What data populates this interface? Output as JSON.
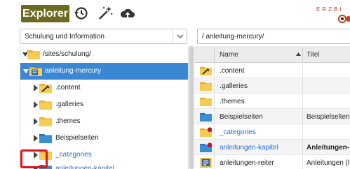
{
  "toolbar": {
    "explorer_label": "Explorer",
    "icons": [
      "history-icon",
      "magic-wand-icon",
      "cloud-upload-icon"
    ],
    "brand_text": "ERZBI"
  },
  "site_select": {
    "value": "Schulung und Information"
  },
  "path_input": {
    "value": "/ anleitung-mercury/"
  },
  "tree": {
    "items": [
      {
        "label": "/sites/schulung/",
        "expanded": true,
        "icon": "folder-icon"
      },
      {
        "label": "anleitung-mercury",
        "expanded": true,
        "selected": true,
        "icon": "site-folder-icon"
      },
      {
        "label": ".content",
        "icon": "tools-folder-icon"
      },
      {
        "label": ".galleries",
        "icon": "folder-icon"
      },
      {
        "label": ".themes",
        "icon": "folder-icon"
      },
      {
        "label": "Beispielseiten",
        "icon": "blue-folder-icon"
      },
      {
        "label": "_categories",
        "icon": "folder-icon",
        "link": true
      },
      {
        "label": "anleitungen-kapitel",
        "icon": "blue-folder-icon",
        "link": true
      }
    ]
  },
  "list": {
    "columns": {
      "name": "Name",
      "title": "Titel"
    },
    "rows": [
      {
        "name": ".content",
        "title": "",
        "icon": "tools-folder-icon"
      },
      {
        "name": ".galleries",
        "title": "",
        "icon": "folder-icon"
      },
      {
        "name": ".themes",
        "title": "",
        "icon": "folder-icon"
      },
      {
        "name": "Beispielseiten",
        "title": "Beispielseiten",
        "icon": "blue-folder-icon"
      },
      {
        "name": "_categories",
        "title": "",
        "icon": "folder-changed-icon",
        "link": true
      },
      {
        "name": "anleitungen-kapitel",
        "title": "Anleitungen-",
        "icon": "blue-folder-changed-icon",
        "link": true,
        "bold_title": true
      },
      {
        "name": "anleitungen-reiter",
        "title": "Anleitungen (I",
        "icon": "container-page-icon"
      }
    ]
  },
  "colors": {
    "explorer_bg": "#6b6a20",
    "selection": "#3c87d3",
    "folder": "#f3c544",
    "blue_folder": "#3a8fd6",
    "link": "#2a6fc9",
    "highlight": "#e0141e",
    "changed_dot": "#c8102e"
  }
}
